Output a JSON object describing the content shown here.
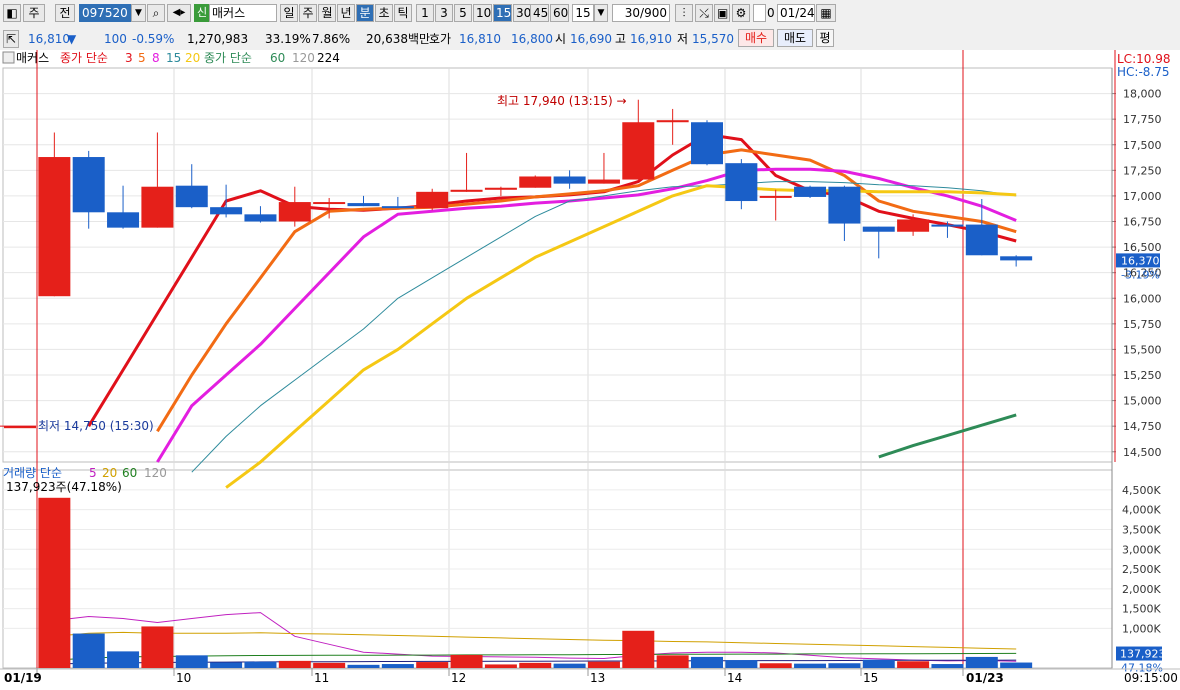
{
  "toolbar": {
    "type_label": "주",
    "full_label": "전",
    "code": "097520",
    "new_badge": "신",
    "name": "매커스",
    "periods": [
      "일",
      "주",
      "월",
      "년",
      "분",
      "초",
      "틱"
    ],
    "active_period": "분",
    "intervals": [
      "1",
      "3",
      "5",
      "10",
      "15",
      "30",
      "45",
      "60"
    ],
    "active_interval": "15",
    "interval_select": "15",
    "count": "30/900",
    "checkbox_num": "0",
    "date": "01/24"
  },
  "quote": {
    "price": "16,810",
    "direction": "▼",
    "change": "100",
    "pct": "-0.59%",
    "volume": "1,270,983",
    "turnover": "33.19%",
    "ratio": "7.86%",
    "amount": "20,638백만",
    "ask_label": "호가",
    "ask1": "16,810",
    "ask2": "16,800",
    "open_label": "시",
    "open": "16,690",
    "high_label": "고",
    "high": "16,910",
    "low_label": "저",
    "low": "15,570",
    "buy_btn": "매수",
    "sell_btn": "매도",
    "eval_btn": "평"
  },
  "price_legend": {
    "name": "매커스",
    "ma1_label": "종가 단순",
    "ma1_periods": [
      "3",
      "5",
      "8",
      "15",
      "20"
    ],
    "ma2_label": "종가 단순",
    "ma2_periods": [
      "60",
      "120",
      "224"
    ]
  },
  "volume_legend": {
    "label": "거래량 단순",
    "periods": [
      "5",
      "20",
      "60",
      "120"
    ],
    "summary": "137,923주(47.18%)"
  },
  "annotations": {
    "high": "최고 17,940 (13:15) →",
    "low": "최저 14,750 (15:30)",
    "lc": "LC:10.98",
    "hc": "HC:-8.75",
    "current_price": "16,370",
    "current_pct": "-3.19%",
    "current_vol": "137,923",
    "current_vol_pct": "47.18%"
  },
  "time_axis": {
    "labels": [
      "01/19",
      "10",
      "11",
      "12",
      "13",
      "14",
      "15",
      "01/23"
    ],
    "end_time": "09:15:00"
  },
  "chart_data": {
    "type": "candlestick",
    "price_ticks": [
      18000,
      17750,
      17500,
      17250,
      17000,
      16750,
      16500,
      16250,
      16000,
      15750,
      15500,
      15250,
      15000,
      14750,
      14500
    ],
    "volume_ticks": [
      4500,
      4000,
      3500,
      3000,
      2500,
      2000,
      1500,
      1000
    ],
    "volume_tick_unit": "K",
    "ylim_price": [
      14400,
      18250
    ],
    "ylim_volume": [
      0,
      4800
    ],
    "candles": [
      {
        "o": 14750,
        "h": 14750,
        "l": 14750,
        "c": 14750,
        "v": 0
      },
      {
        "o": 16020,
        "h": 17620,
        "l": 16020,
        "c": 17380,
        "v": 4300
      },
      {
        "o": 17380,
        "h": 17440,
        "l": 16680,
        "c": 16840,
        "v": 870
      },
      {
        "o": 16840,
        "h": 17100,
        "l": 16680,
        "c": 16690,
        "v": 420
      },
      {
        "o": 16690,
        "h": 17620,
        "l": 16690,
        "c": 17090,
        "v": 1050
      },
      {
        "o": 17100,
        "h": 17310,
        "l": 16880,
        "c": 16890,
        "v": 320
      },
      {
        "o": 16890,
        "h": 17110,
        "l": 16790,
        "c": 16820,
        "v": 140
      },
      {
        "o": 16820,
        "h": 16900,
        "l": 16740,
        "c": 16750,
        "v": 160
      },
      {
        "o": 16750,
        "h": 17090,
        "l": 16700,
        "c": 16940,
        "v": 180
      },
      {
        "o": 16940,
        "h": 16980,
        "l": 16780,
        "c": 16940,
        "v": 130
      },
      {
        "o": 16930,
        "h": 17000,
        "l": 16900,
        "c": 16900,
        "v": 80
      },
      {
        "o": 16900,
        "h": 16990,
        "l": 16880,
        "c": 16890,
        "v": 100
      },
      {
        "o": 16880,
        "h": 17070,
        "l": 16860,
        "c": 17040,
        "v": 150
      },
      {
        "o": 17040,
        "h": 17420,
        "l": 17040,
        "c": 17060,
        "v": 330
      },
      {
        "o": 17060,
        "h": 17090,
        "l": 17000,
        "c": 17080,
        "v": 90
      },
      {
        "o": 17080,
        "h": 17200,
        "l": 17080,
        "c": 17190,
        "v": 130
      },
      {
        "o": 17190,
        "h": 17250,
        "l": 17070,
        "c": 17120,
        "v": 110
      },
      {
        "o": 17120,
        "h": 17420,
        "l": 17120,
        "c": 17160,
        "v": 160
      },
      {
        "o": 17160,
        "h": 17940,
        "l": 17160,
        "c": 17720,
        "v": 940
      },
      {
        "o": 17720,
        "h": 17850,
        "l": 17500,
        "c": 17740,
        "v": 320
      },
      {
        "o": 17720,
        "h": 17740,
        "l": 17300,
        "c": 17310,
        "v": 280
      },
      {
        "o": 17320,
        "h": 17360,
        "l": 16870,
        "c": 16950,
        "v": 200
      },
      {
        "o": 17000,
        "h": 17060,
        "l": 16760,
        "c": 17000,
        "v": 120
      },
      {
        "o": 17090,
        "h": 17100,
        "l": 16980,
        "c": 16990,
        "v": 110
      },
      {
        "o": 17090,
        "h": 17100,
        "l": 16560,
        "c": 16730,
        "v": 120
      },
      {
        "o": 16700,
        "h": 16700,
        "l": 16390,
        "c": 16650,
        "v": 210
      },
      {
        "o": 16650,
        "h": 16820,
        "l": 16610,
        "c": 16770,
        "v": 170
      },
      {
        "o": 16720,
        "h": 16750,
        "l": 16590,
        "c": 16700,
        "v": 100
      },
      {
        "o": 16720,
        "h": 16970,
        "l": 16420,
        "c": 16420,
        "v": 280
      },
      {
        "o": 16410,
        "h": 16420,
        "l": 16310,
        "c": 16370,
        "v": 138
      }
    ],
    "moving_averages": [
      {
        "name": "3",
        "color": "#e0101a",
        "values": [
          null,
          null,
          14750,
          15300,
          15850,
          16400,
          16950,
          17050,
          16900,
          16870,
          16860,
          16880,
          16910,
          16950,
          16980,
          16990,
          17010,
          17040,
          17140,
          17400,
          17600,
          17550,
          17200,
          17050,
          17000,
          16850,
          16780,
          16720,
          16650,
          16560
        ]
      },
      {
        "name": "5",
        "color": "#f26b14",
        "values": [
          null,
          null,
          null,
          null,
          14700,
          15250,
          15750,
          16200,
          16650,
          16850,
          16870,
          16880,
          16890,
          16920,
          16950,
          16990,
          17020,
          17050,
          17100,
          17250,
          17400,
          17450,
          17400,
          17350,
          17200,
          16950,
          16850,
          16800,
          16750,
          16650
        ]
      },
      {
        "name": "8",
        "color": "#e31ee0",
        "values": [
          null,
          null,
          null,
          null,
          14400,
          14950,
          15250,
          15550,
          15900,
          16250,
          16600,
          16820,
          16850,
          16880,
          16900,
          16930,
          16950,
          16980,
          17010,
          17070,
          17150,
          17250,
          17260,
          17260,
          17240,
          17170,
          17080,
          17000,
          16900,
          16760
        ]
      },
      {
        "name": "15",
        "color": "#2e8b9c",
        "values": [
          null,
          null,
          null,
          null,
          null,
          14300,
          14650,
          14950,
          15200,
          15450,
          15700,
          16000,
          16200,
          16400,
          16600,
          16800,
          16950,
          17000,
          17050,
          17090,
          17100,
          17120,
          17140,
          17140,
          17130,
          17110,
          17100,
          17080,
          17050,
          17000
        ]
      },
      {
        "name": "20",
        "color": "#f5c814",
        "values": [
          null,
          null,
          null,
          null,
          null,
          null,
          14150,
          14400,
          14700,
          15000,
          15300,
          15500,
          15750,
          16000,
          16200,
          16400,
          16550,
          16700,
          16850,
          17000,
          17100,
          17080,
          17060,
          17050,
          17050,
          17040,
          17040,
          17040,
          17030,
          17010
        ]
      },
      {
        "name": "60",
        "color": "#2e8b57",
        "values": [
          null,
          null,
          null,
          null,
          null,
          null,
          null,
          null,
          null,
          null,
          null,
          null,
          null,
          null,
          null,
          null,
          null,
          null,
          null,
          null,
          null,
          null,
          null,
          null,
          null,
          14450,
          14560,
          14660,
          14760,
          14860
        ]
      }
    ],
    "volume_mas": [
      {
        "name": "5",
        "color": "#c020c0",
        "values": [
          null,
          1200,
          1300,
          1250,
          1150,
          1250,
          1350,
          1400,
          800,
          600,
          400,
          350,
          300,
          290,
          280,
          270,
          250,
          240,
          320,
          380,
          400,
          400,
          380,
          320,
          260,
          230,
          200,
          180,
          190,
          170
        ]
      },
      {
        "name": "20",
        "color": "#d0a000",
        "values": [
          null,
          800,
          880,
          900,
          880,
          880,
          880,
          890,
          870,
          860,
          840,
          820,
          800,
          780,
          760,
          740,
          720,
          700,
          690,
          670,
          660,
          640,
          620,
          600,
          580,
          560,
          540,
          520,
          500,
          480
        ]
      },
      {
        "name": "60",
        "color": "#208020",
        "values": [
          null,
          200,
          250,
          280,
          290,
          300,
          310,
          315,
          318,
          320,
          322,
          325,
          327,
          330,
          332,
          335,
          337,
          340,
          342,
          345,
          347,
          350,
          352,
          355,
          357,
          360,
          362,
          365,
          367,
          370
        ]
      },
      {
        "name": "120",
        "color": "#202080",
        "values": [
          null,
          100,
          120,
          130,
          140,
          145,
          150,
          155,
          158,
          160,
          162,
          164,
          166,
          168,
          170,
          172,
          174,
          176,
          178,
          180,
          182,
          184,
          186,
          188,
          190,
          192,
          194,
          196,
          198,
          200
        ]
      }
    ],
    "colors": {
      "up": "#e5201a",
      "down": "#1a5fc8",
      "grid": "#dcdcdc"
    }
  }
}
